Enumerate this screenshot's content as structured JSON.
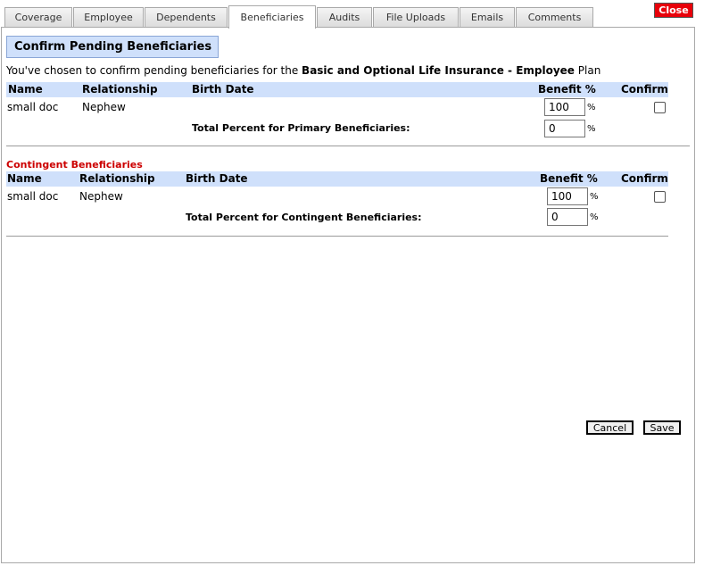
{
  "tabs": [
    {
      "label": "Coverage"
    },
    {
      "label": "Employee"
    },
    {
      "label": "Dependents"
    },
    {
      "label": "Beneficiaries",
      "active": true
    },
    {
      "label": "Audits"
    },
    {
      "label": "File Uploads"
    },
    {
      "label": "Emails"
    },
    {
      "label": "Comments"
    }
  ],
  "close_label": "Close",
  "page_title": "Confirm Pending Beneficiaries",
  "intro": {
    "prefix": "You've chosen to confirm pending beneficiaries for the ",
    "plan_name": "Basic and Optional Life Insurance - Employee",
    "suffix": " Plan"
  },
  "columns": {
    "name": "Name",
    "relationship": "Relationship",
    "birth_date": "Birth Date",
    "benefit": "Benefit %",
    "confirm": "Confirm"
  },
  "primary": {
    "rows": [
      {
        "name": "small doc",
        "relationship": "Nephew",
        "birth_date": "",
        "benefit": "100",
        "confirmed": false
      }
    ],
    "total_label": "Total Percent for Primary Beneficiaries:",
    "total_value": "0"
  },
  "contingent": {
    "title": "Contingent Beneficiaries",
    "rows": [
      {
        "name": "small doc",
        "relationship": "Nephew",
        "birth_date": "",
        "benefit": "100",
        "confirmed": false
      }
    ],
    "total_label": "Total Percent for Contingent Beneficiaries:",
    "total_value": "0"
  },
  "percent_symbol": "%",
  "buttons": {
    "cancel": "Cancel",
    "save": "Save"
  },
  "colors": {
    "header_bg": "#cfe0fb",
    "close_bg": "#e8000a",
    "section_title": "#cc0000"
  }
}
